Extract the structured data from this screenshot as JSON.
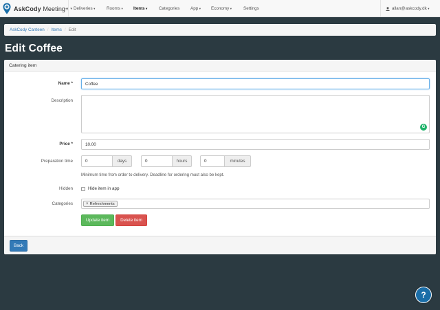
{
  "navbar": {
    "brand_bold": "AskCody",
    "brand_light": " Meeting+",
    "items": [
      {
        "label": "Deliveries",
        "dropdown": true,
        "active": false
      },
      {
        "label": "Rooms",
        "dropdown": true,
        "active": false
      },
      {
        "label": "Items",
        "dropdown": true,
        "active": true
      },
      {
        "label": "Categories",
        "dropdown": false,
        "active": false
      },
      {
        "label": "App",
        "dropdown": true,
        "active": false
      },
      {
        "label": "Economy",
        "dropdown": true,
        "active": false
      },
      {
        "label": "Settings",
        "dropdown": false,
        "active": false
      }
    ],
    "user": "allan@askcody.dk",
    "caret": "▾"
  },
  "breadcrumb": {
    "items": [
      "AskCody Canteen",
      "Items"
    ],
    "current": "Edit",
    "separator": "/"
  },
  "page_title": "Edit Coffee",
  "panel": {
    "heading": "Catering item"
  },
  "form": {
    "name_label": "Name *",
    "name_value": "Coffee",
    "description_label": "Description",
    "description_value": "",
    "grammarly_badge": "G",
    "price_label": "Price *",
    "price_value": "10.00",
    "prep_label": "Preparation time",
    "days_value": "0",
    "days_addon": "days",
    "hours_value": "0",
    "hours_addon": "hours",
    "minutes_value": "0",
    "minutes_addon": "minutes",
    "prep_help": "Minimum time from order to delivery. Deadline for ordering must also be kept.",
    "hidden_label": "Hidden",
    "hidden_checkbox_label": "Hide item in app",
    "hidden_checked": false,
    "categories_label": "Categories",
    "categories": [
      {
        "label": "Refreshments",
        "remove": "×"
      }
    ],
    "update_button": "Update item",
    "delete_button": "Delete item"
  },
  "footer": {
    "back_button": "Back"
  },
  "help_button": "?",
  "colors": {
    "background": "#2b3a41",
    "brand_blue": "#1a6ea8",
    "success": "#5cb85c",
    "danger": "#d9534f",
    "primary": "#337ab7"
  }
}
